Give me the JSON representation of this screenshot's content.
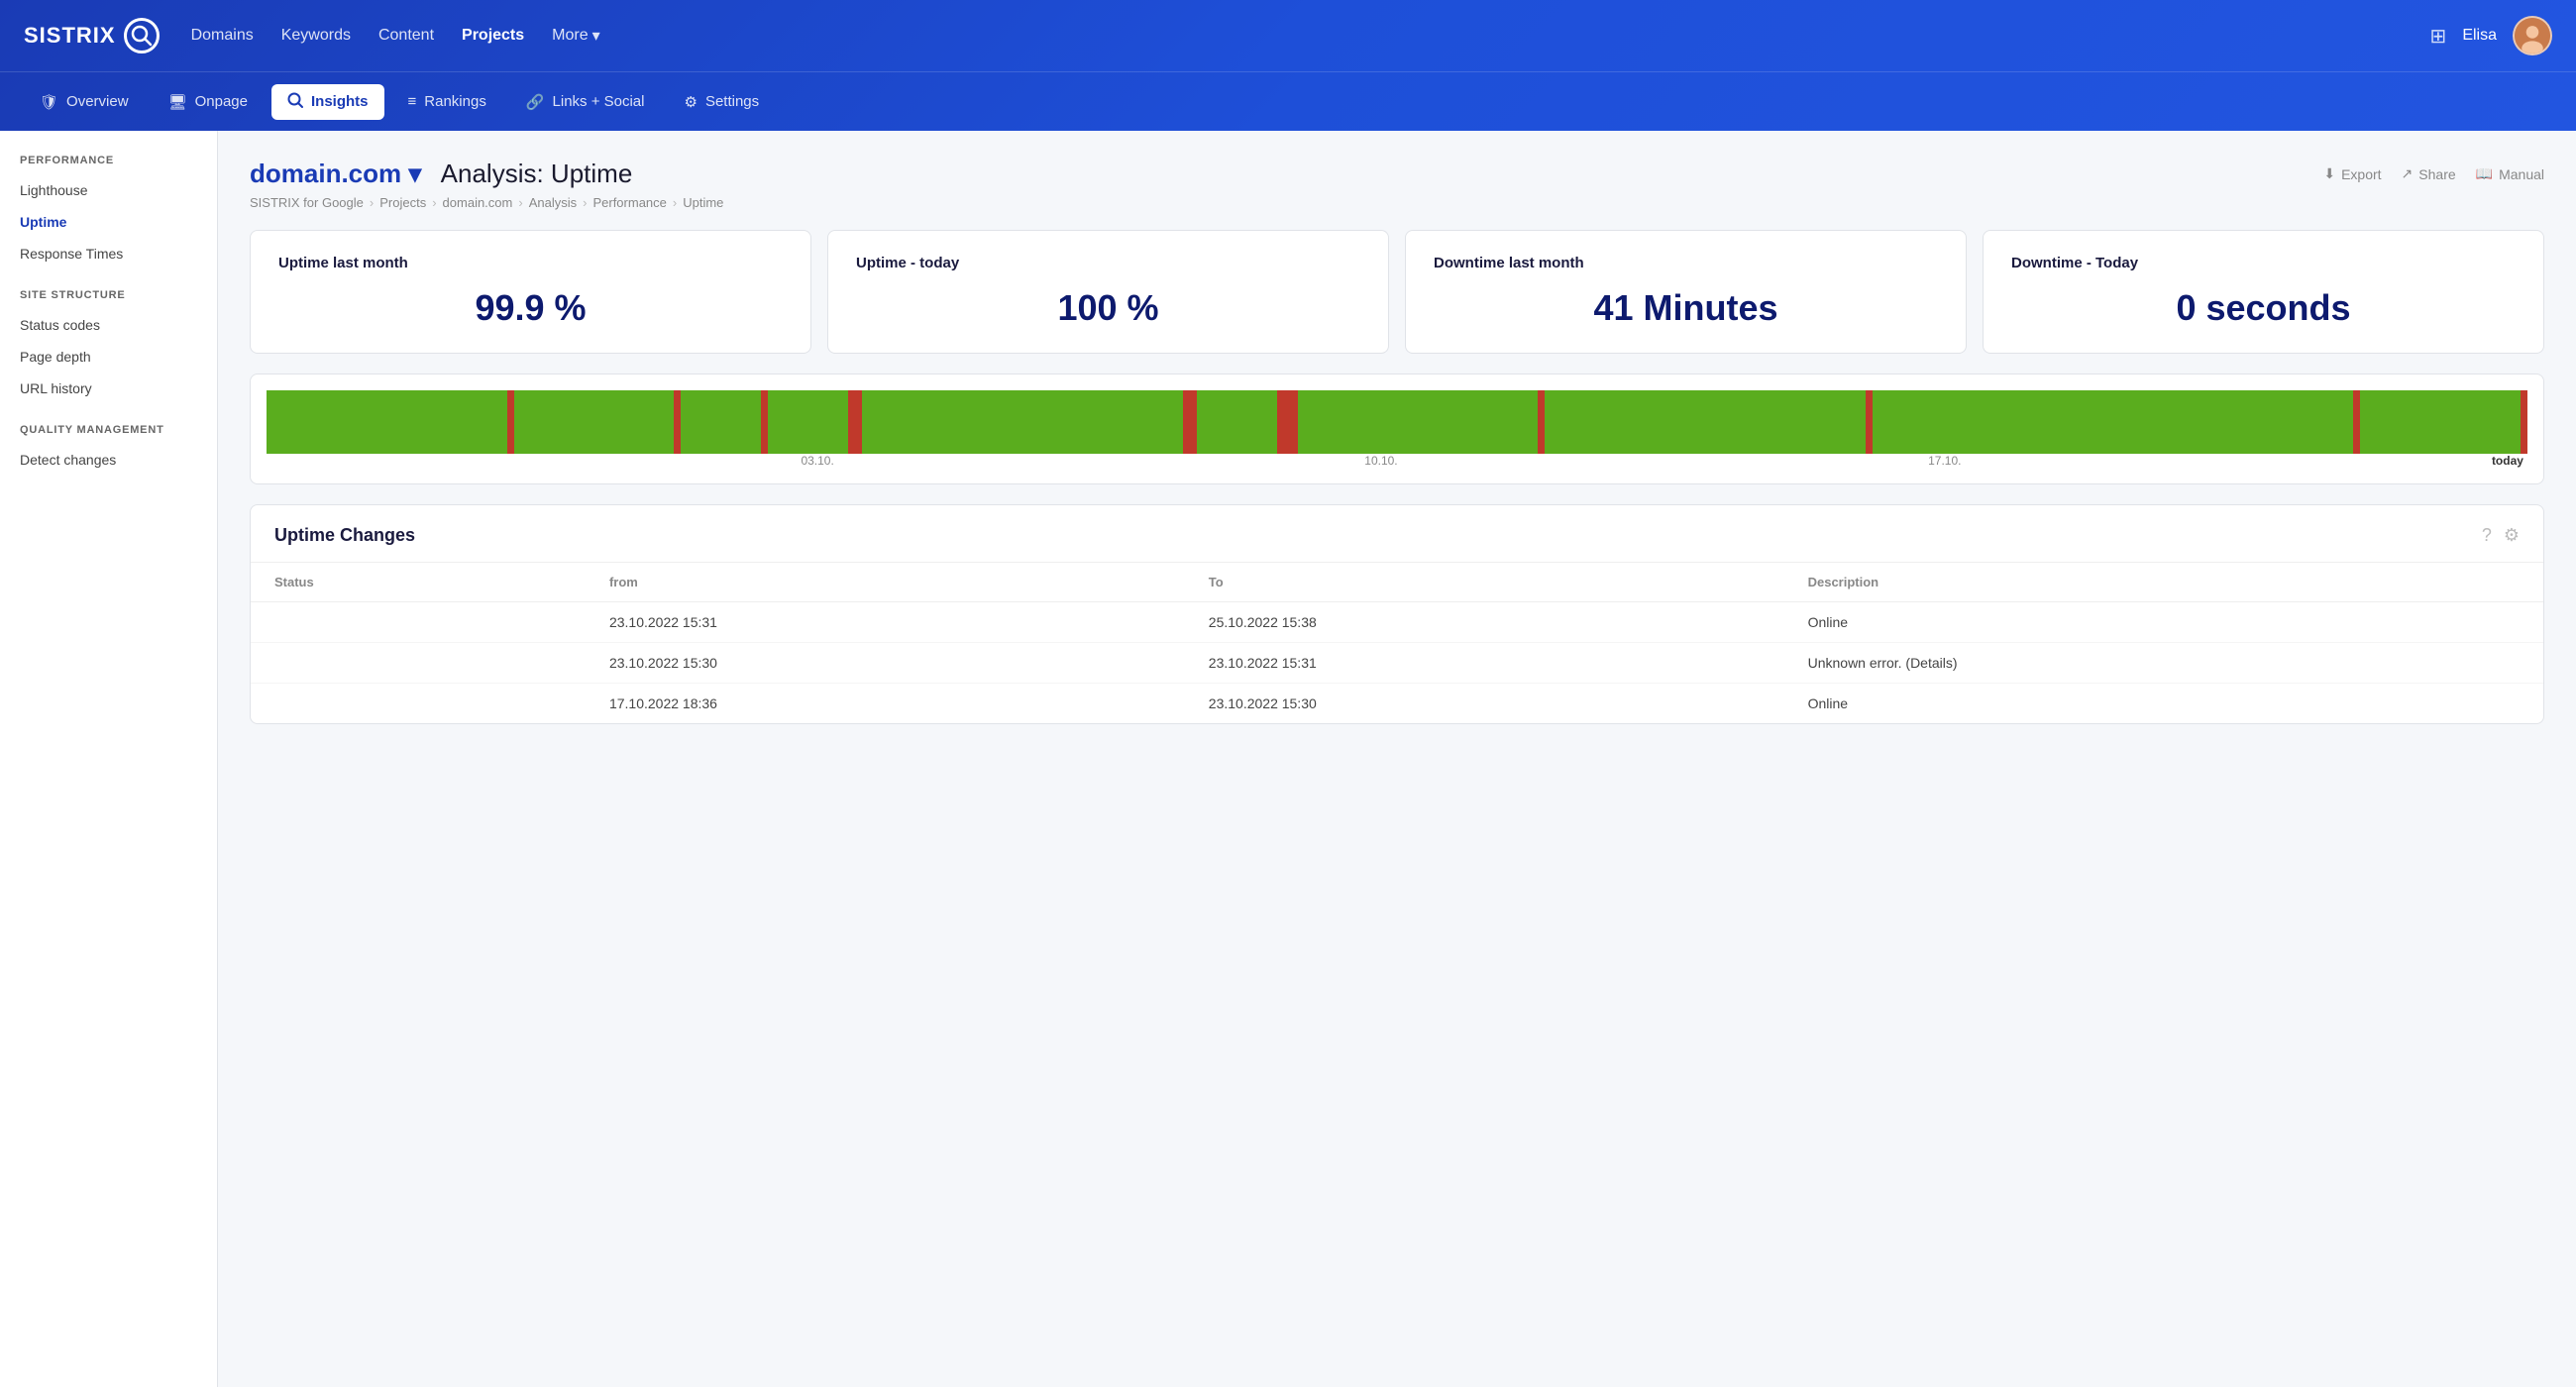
{
  "logo": {
    "text": "SISTRIX",
    "icon": "🔍"
  },
  "topNav": {
    "items": [
      {
        "label": "Domains",
        "active": false
      },
      {
        "label": "Keywords",
        "active": false
      },
      {
        "label": "Content",
        "active": false
      },
      {
        "label": "Projects",
        "active": true
      },
      {
        "label": "More",
        "active": false,
        "hasArrow": true
      }
    ]
  },
  "subNav": {
    "items": [
      {
        "label": "Overview",
        "icon": "📋",
        "active": false
      },
      {
        "label": "Onpage",
        "icon": "🖥",
        "active": false
      },
      {
        "label": "Insights",
        "icon": "🔍",
        "active": true
      },
      {
        "label": "Rankings",
        "icon": "≡",
        "active": false
      },
      {
        "label": "Links + Social",
        "icon": "🔗",
        "active": false
      },
      {
        "label": "Settings",
        "icon": "⚙",
        "active": false
      }
    ]
  },
  "sidebar": {
    "sections": [
      {
        "title": "PERFORMANCE",
        "items": [
          {
            "label": "Lighthouse",
            "active": false
          },
          {
            "label": "Uptime",
            "active": true
          },
          {
            "label": "Response Times",
            "active": false
          }
        ]
      },
      {
        "title": "SITE STRUCTURE",
        "items": [
          {
            "label": "Status codes",
            "active": false
          },
          {
            "label": "Page depth",
            "active": false
          },
          {
            "label": "URL history",
            "active": false
          }
        ]
      },
      {
        "title": "QUALITY MANAGEMENT",
        "items": [
          {
            "label": "Detect changes",
            "active": false
          }
        ]
      }
    ]
  },
  "page": {
    "domain": "domain.com",
    "title": "Analysis: Uptime",
    "breadcrumbs": [
      "SISTRIX for Google",
      "Projects",
      "domain.com",
      "Analysis",
      "Performance",
      "Uptime"
    ],
    "actions": [
      {
        "label": "Export",
        "icon": "⬇"
      },
      {
        "label": "Share",
        "icon": "↗"
      },
      {
        "label": "Manual",
        "icon": "📖"
      }
    ]
  },
  "cards": [
    {
      "label": "Uptime last month",
      "value": "99.9 %"
    },
    {
      "label": "Uptime - today",
      "value": "100 %"
    },
    {
      "label": "Downtime last month",
      "value": "41 Minutes"
    },
    {
      "label": "Downtime - Today",
      "value": "0 seconds"
    }
  ],
  "chart": {
    "labels": [
      "03.10.",
      "10.10.",
      "17.10.",
      "today"
    ]
  },
  "table": {
    "title": "Uptime Changes",
    "columns": [
      "Status",
      "from",
      "To",
      "Description"
    ],
    "rows": [
      {
        "from": "23.10.2022 15:31",
        "to": "25.10.2022 15:38",
        "description": "Online"
      },
      {
        "from": "23.10.2022 15:30",
        "to": "23.10.2022 15:31",
        "description": "Unknown error. (Details)"
      },
      {
        "from": "17.10.2022 18:36",
        "to": "23.10.2022 15:30",
        "description": "Online"
      }
    ]
  },
  "user": {
    "name": "Elisa"
  }
}
